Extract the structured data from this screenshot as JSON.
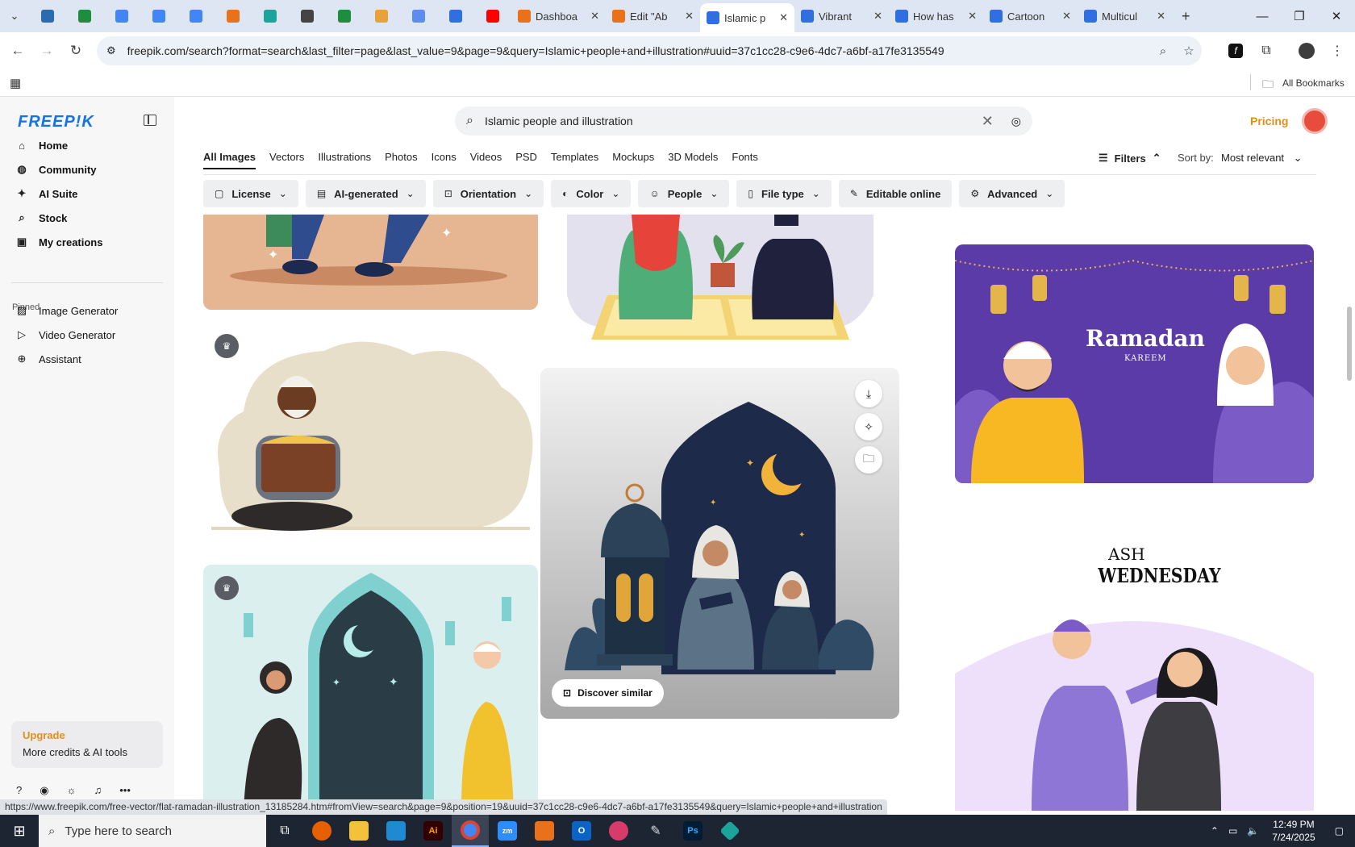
{
  "browser": {
    "tabs": [
      {
        "title": "",
        "icon": "wordpress-icon",
        "color": "#2b6cb0"
      },
      {
        "title": "",
        "icon": "sheets-icon",
        "color": "#1e8e3e"
      },
      {
        "title": "",
        "icon": "docs-icon",
        "color": "#4285f4"
      },
      {
        "title": "",
        "icon": "docs-icon",
        "color": "#4285f4"
      },
      {
        "title": "",
        "icon": "docs-icon",
        "color": "#4285f4"
      },
      {
        "title": "",
        "icon": "orange-app-icon",
        "color": "#e8711a"
      },
      {
        "title": "",
        "icon": "teal-app-icon",
        "color": "#1ba39c"
      },
      {
        "title": "",
        "icon": "openai-icon",
        "color": "#444444"
      },
      {
        "title": "",
        "icon": "sheets-icon",
        "color": "#1e8e3e"
      },
      {
        "title": "",
        "icon": "hand-icon",
        "color": "#e8a23a"
      },
      {
        "title": "",
        "icon": "grid-app-icon",
        "color": "#5b8def"
      },
      {
        "title": "",
        "icon": "forms-icon",
        "color": "#2f6fe0"
      },
      {
        "title": "",
        "icon": "youtube-icon",
        "color": "#ff0000"
      },
      {
        "title": "Dashboa",
        "icon": "orange-app-icon",
        "color": "#e8711a"
      },
      {
        "title": "Edit \"Ab",
        "icon": "orange-app-icon",
        "color": "#e8711a"
      },
      {
        "title": "Islamic p",
        "icon": "forms-icon",
        "color": "#2f6fe0",
        "active": true
      },
      {
        "title": "Vibrant",
        "icon": "forms-icon",
        "color": "#2f6fe0"
      },
      {
        "title": "How has",
        "icon": "forms-icon",
        "color": "#2f6fe0"
      },
      {
        "title": "Cartoon",
        "icon": "forms-icon",
        "color": "#2f6fe0"
      },
      {
        "title": "Multicul",
        "icon": "forms-icon",
        "color": "#2f6fe0"
      }
    ],
    "new_tab_label": "+",
    "url": "freepik.com/search?format=search&last_filter=page&last_value=9&page=9&query=Islamic+people+and+illustration#uuid=37c1cc28-c9e6-4dc7-a6bf-a17fe3135549",
    "all_bookmarks": "All Bookmarks",
    "status_url": "https://www.freepik.com/free-vector/flat-ramadan-illustration_13185284.htm#fromView=search&page=9&position=19&uuid=37c1cc28-c9e6-4dc7-a6bf-a17fe3135549&query=Islamic+people+and+illustration"
  },
  "sidebar": {
    "logo": "FREEP!K",
    "nav": [
      {
        "label": "Home",
        "icon": "home-icon"
      },
      {
        "label": "Community",
        "icon": "globe-icon"
      },
      {
        "label": "AI Suite",
        "icon": "sparkle-icon"
      },
      {
        "label": "Stock",
        "icon": "search-icon"
      },
      {
        "label": "My creations",
        "icon": "folder-icon"
      }
    ],
    "pinned_label": "Pinned",
    "pinned": [
      {
        "label": "Image Generator",
        "icon": "image-icon"
      },
      {
        "label": "Video Generator",
        "icon": "video-icon"
      },
      {
        "label": "Assistant",
        "icon": "assistant-icon"
      }
    ],
    "upgrade_title": "Upgrade",
    "upgrade_sub": "More credits & AI tools"
  },
  "header": {
    "search_query": "Islamic people and illustration",
    "pricing": "Pricing"
  },
  "content_tabs": [
    "All Images",
    "Vectors",
    "Illustrations",
    "Photos",
    "Icons",
    "Videos",
    "PSD",
    "Templates",
    "Mockups",
    "3D Models",
    "Fonts"
  ],
  "filters_label": "Filters",
  "sort_label": "Sort by:",
  "sort_value": "Most relevant",
  "chips": [
    {
      "label": "License",
      "icon": "license-icon"
    },
    {
      "label": "AI-generated",
      "icon": "ai-icon"
    },
    {
      "label": "Orientation",
      "icon": "orientation-icon"
    },
    {
      "label": "Color",
      "icon": "palette-icon"
    },
    {
      "label": "People",
      "icon": "people-icon"
    },
    {
      "label": "File type",
      "icon": "file-icon"
    },
    {
      "label": "Editable online",
      "icon": "pencil-icon"
    },
    {
      "label": "Advanced",
      "icon": "gear-icon"
    }
  ],
  "cards": {
    "discover_similar": "Discover similar",
    "ramadan_title": "Ramadan",
    "ramadan_sub": "KAREEM",
    "ash_line1": "ASH",
    "ash_line2": "WEDNESDAY"
  },
  "taskbar": {
    "search_placeholder": "Type here to search",
    "time": "12:49 PM",
    "date": "7/24/2025"
  }
}
